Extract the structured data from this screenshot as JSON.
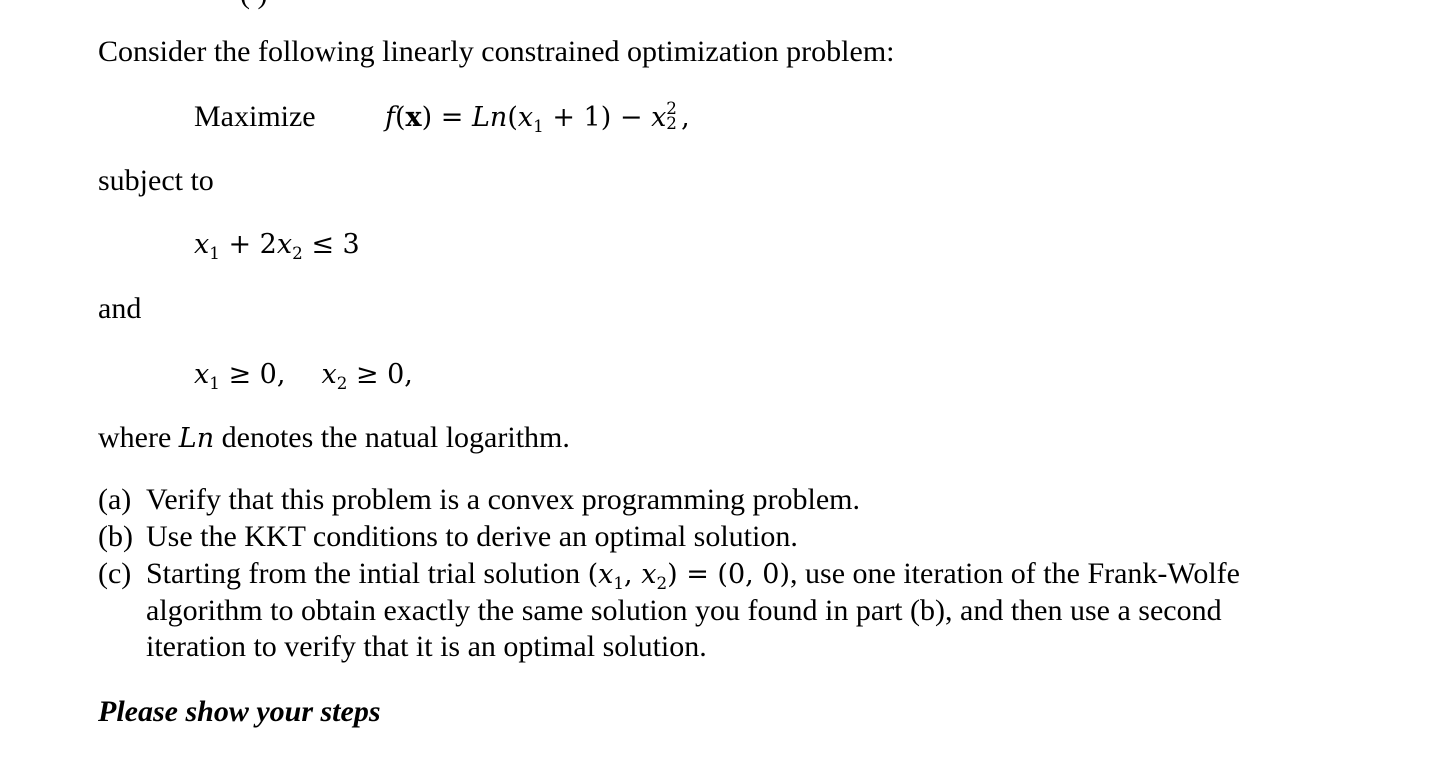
{
  "document": {
    "cutoff_top_fragment": "( )",
    "intro": "Consider the following linearly constrained optimization problem:",
    "objective": {
      "keyword": "Maximize",
      "lhs": "f",
      "lhs_arg_open": "(",
      "lhs_arg": "x",
      "lhs_arg_close": ")",
      "equals": " = ",
      "ln": "Ln",
      "open_paren": "(",
      "x": "x",
      "sub1": "1",
      "plus_one": " + 1)",
      "minus": " − ",
      "x2": "x",
      "sup2": "2",
      "sub2": "2",
      "trailing": ","
    },
    "subject_to": "subject to",
    "constraint1": {
      "x": "x",
      "sub1": "1",
      "middle": " + 2",
      "x2": "x",
      "sub2": "2",
      "rhs": " ≤ 3"
    },
    "and": "and",
    "nonneg": {
      "x": "x",
      "sub1": "1",
      "rhs1": " ≥ 0,",
      "x2": "x",
      "sub2": "2",
      "rhs2": " ≥ 0,"
    },
    "ln_note": {
      "before": "where ",
      "ln": "Ln",
      "after": " denotes the natual logarithm."
    },
    "parts": [
      {
        "label": "(a)",
        "text": "Verify that this problem is a convex programming problem."
      },
      {
        "label": "(b)",
        "text": "Use the KKT conditions to derive an optimal solution."
      },
      {
        "label": "(c)",
        "text_before": "Starting from the intial trial solution ",
        "math_open": "(",
        "x": "x",
        "sub1": "1",
        "comma": ", ",
        "x2": "x",
        "sub2": "2",
        "math_mid": ") = (0, 0)",
        "text_after": ", use one iteration of the Frank-Wolfe algorithm to obtain exactly the same solution you found in part (b), and then use a second iteration to verify that it is an optimal solution."
      }
    ],
    "closing": "Please show your steps"
  }
}
